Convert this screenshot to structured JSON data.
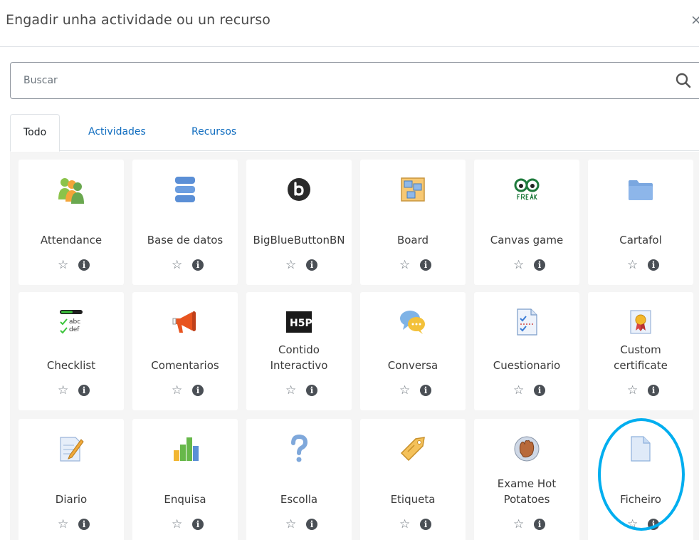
{
  "header": {
    "title": "Engadir unha actividade ou un recurso",
    "close_label": "×"
  },
  "search": {
    "placeholder": "Buscar"
  },
  "tabs": [
    {
      "label": "Todo",
      "active": true
    },
    {
      "label": "Actividades",
      "active": false
    },
    {
      "label": "Recursos",
      "active": false
    }
  ],
  "modules": [
    {
      "name": "Attendance",
      "icon": "attendance-icon"
    },
    {
      "name": "Base de datos",
      "icon": "database-icon"
    },
    {
      "name": "BigBlueButtonBN",
      "icon": "bigbluebutton-icon"
    },
    {
      "name": "Board",
      "icon": "board-icon"
    },
    {
      "name": "Canvas game",
      "icon": "freak-glasses-icon"
    },
    {
      "name": "Cartafol",
      "icon": "folder-icon"
    },
    {
      "name": "Checklist",
      "icon": "checklist-icon"
    },
    {
      "name": "Comentarios",
      "icon": "megaphone-icon"
    },
    {
      "name": "Contido Interactivo",
      "icon": "h5p-icon"
    },
    {
      "name": "Conversa",
      "icon": "chat-bubbles-icon"
    },
    {
      "name": "Cuestionario",
      "icon": "quiz-icon"
    },
    {
      "name": "Custom certificate",
      "icon": "certificate-icon"
    },
    {
      "name": "Diario",
      "icon": "journal-icon"
    },
    {
      "name": "Enquisa",
      "icon": "bar-chart-icon"
    },
    {
      "name": "Escolla",
      "icon": "question-mark-icon"
    },
    {
      "name": "Etiqueta",
      "icon": "tag-icon"
    },
    {
      "name": "Exame Hot Potatoes",
      "icon": "hot-potatoes-icon"
    },
    {
      "name": "Ficheiro",
      "icon": "file-icon"
    }
  ],
  "actions": {
    "star": "☆",
    "info": "i"
  },
  "colors": {
    "link": "#0f6cbf",
    "highlight": "#00aeef",
    "grid_background": "#f5f5f5"
  }
}
